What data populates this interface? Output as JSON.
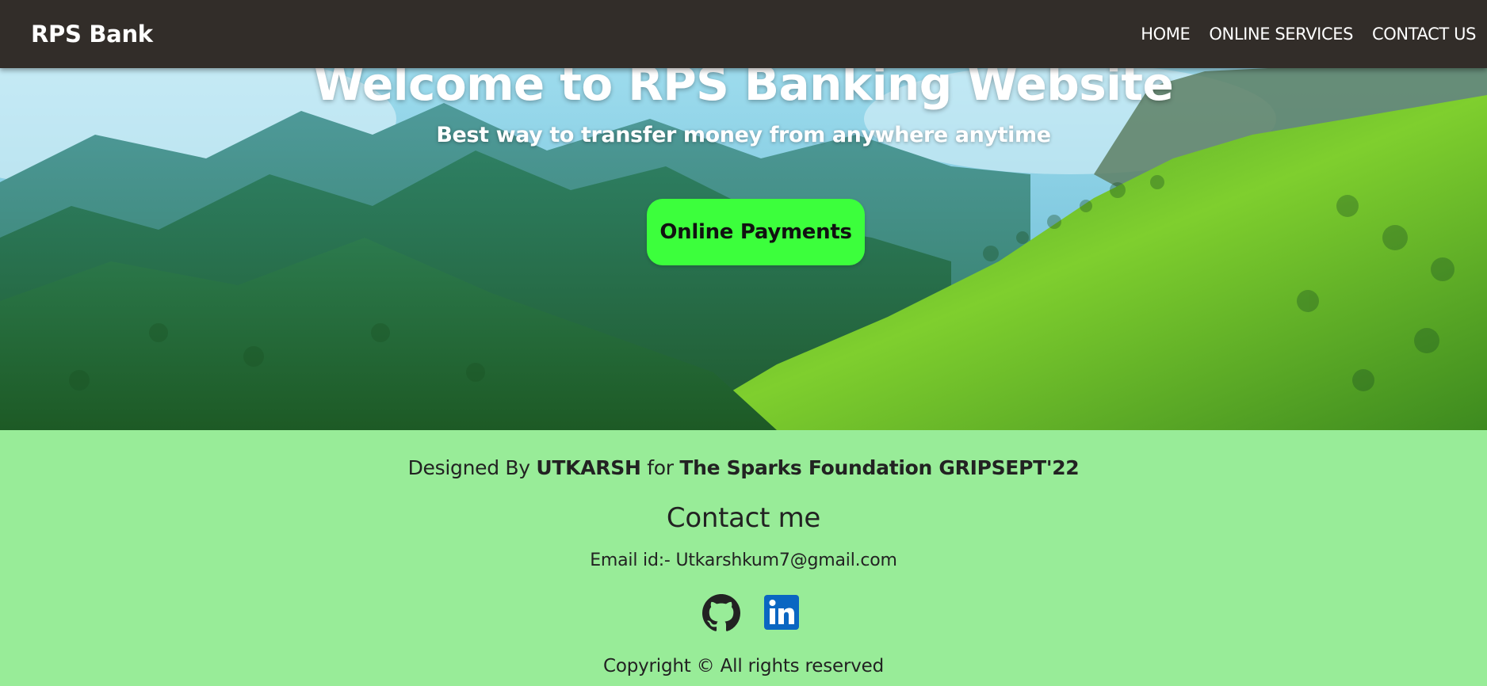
{
  "navbar": {
    "brand": "RPS Bank",
    "links": [
      "HOME",
      "ONLINE SERVICES",
      "CONTACT US"
    ]
  },
  "hero": {
    "title": "Welcome to RPS Banking Website",
    "subtitle": "Best way to transfer money from anywhere anytime",
    "button_label": "Online Payments",
    "button_color": "#3cff3c"
  },
  "footer": {
    "designed_by_prefix": "Designed By",
    "designer": "UTKARSH",
    "for_text": "for",
    "organization": "The Sparks Foundation GRIPSEPT'22",
    "contact_heading": "Contact me",
    "email": "Email id:- Utkarshkum7@gmail.com",
    "social_icons": [
      "github-icon",
      "linkedin-icon"
    ],
    "copyright": "Copyright © All rights reserved",
    "background_color": "#98ec98"
  },
  "colors": {
    "navbar_bg": "#322d29",
    "linkedin_blue": "#0a66c2"
  }
}
